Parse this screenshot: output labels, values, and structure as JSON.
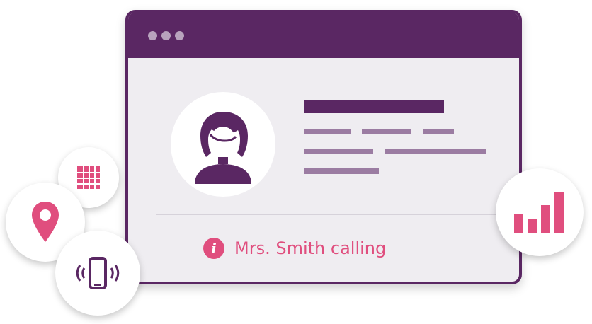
{
  "window": {
    "dots_count": 3
  },
  "caller": {
    "status_text": "Mrs. Smith calling",
    "info_icon": "i"
  },
  "icons": {
    "avatar": "user-avatar-icon",
    "calendar": "calendar-grid-icon",
    "location": "map-pin-icon",
    "phone": "vibrating-phone-icon",
    "signal": "signal-bars-icon"
  },
  "colors": {
    "brand_purple": "#5a2763",
    "placeholder_purple": "#9b7ca2",
    "accent_pink": "#e04e7e",
    "window_bg": "#efedf1",
    "titlebar_dot": "#b8a3bd"
  }
}
